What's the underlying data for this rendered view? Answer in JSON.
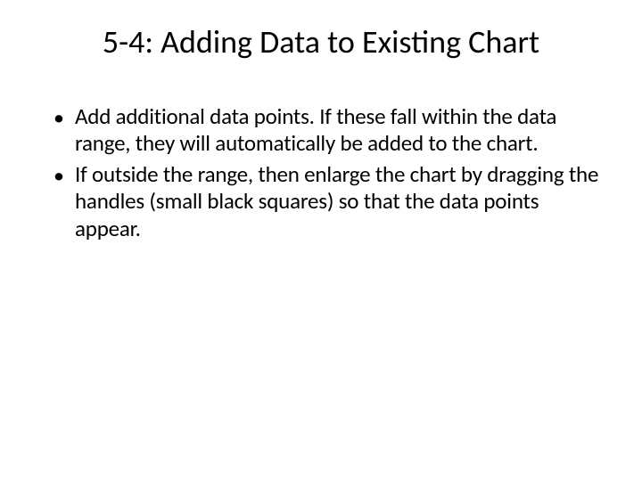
{
  "slide": {
    "title": "5-4: Adding Data to Existing Chart",
    "bullets": [
      "Add additional data points.  If these fall within the data range, they will automatically be added to the chart.",
      "If outside the range, then enlarge the chart by dragging the handles (small black squares) so that the data points appear."
    ]
  }
}
